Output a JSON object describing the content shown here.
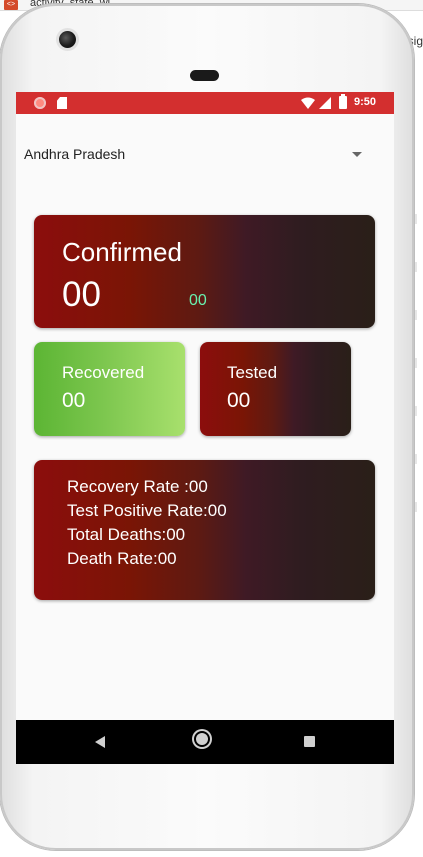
{
  "background_editor": {
    "tab_text": "activity_state_wi...",
    "right_text": "sig"
  },
  "status_bar": {
    "time": "9:50",
    "color": "#d32f2f",
    "icons": [
      "record-icon",
      "sim-icon",
      "wifi-icon",
      "signal-icon",
      "battery-icon"
    ]
  },
  "state_spinner": {
    "selected": "Andhra Pradesh"
  },
  "confirmed_card": {
    "title": "Confirmed",
    "count": "00",
    "delta": "00",
    "delta_color": "#69f0ae"
  },
  "recovered_card": {
    "title": "Recovered",
    "count": "00"
  },
  "tested_card": {
    "title": "Tested",
    "count": "00"
  },
  "stats_card": {
    "recovery_rate": "Recovery Rate :00",
    "test_positive_rate": "Test Positive Rate:00",
    "total_deaths": "Total Deaths:00",
    "death_rate": "Death Rate:00"
  },
  "nav_bar": {
    "icons": [
      "back-icon",
      "home-icon",
      "recents-icon"
    ]
  },
  "colors": {
    "card_dark_start": "#8c0d0d",
    "card_dark_end": "#2a1f18",
    "card_green_start": "#5cb534",
    "card_green_end": "#a8e06d"
  }
}
